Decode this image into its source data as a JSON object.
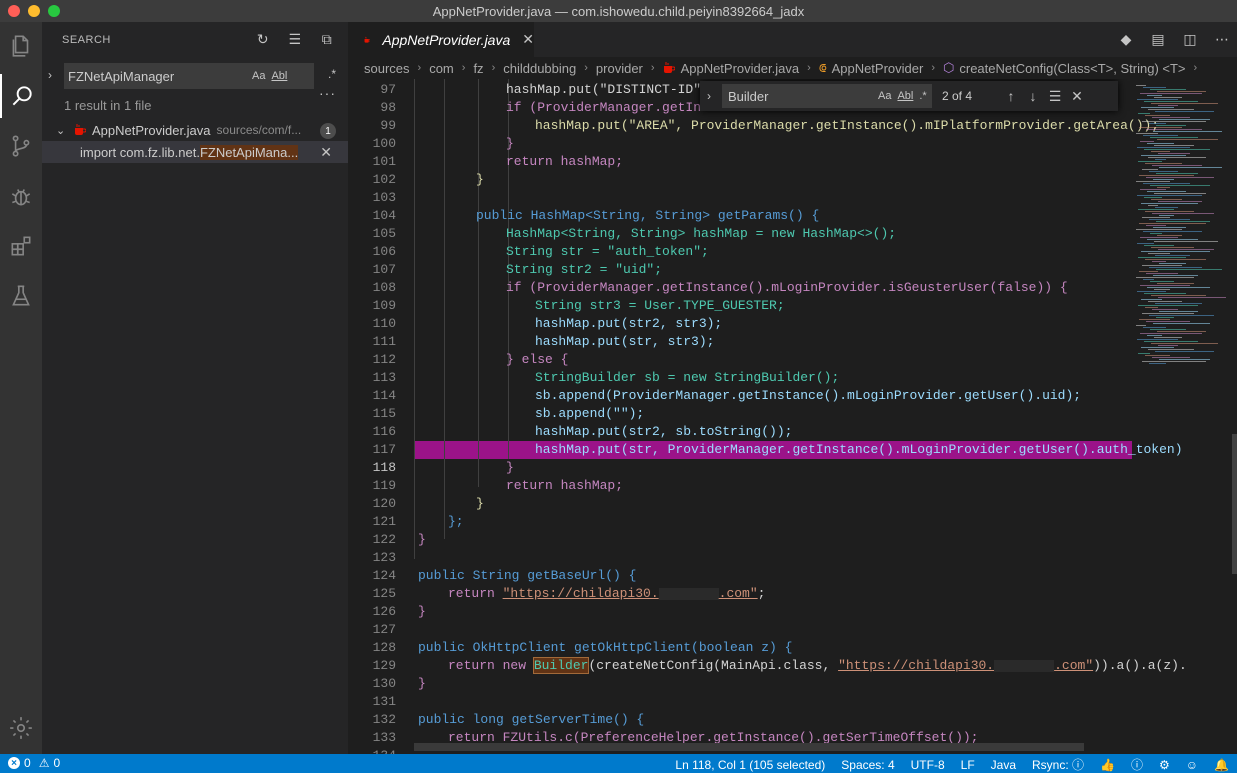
{
  "window": {
    "title": "AppNetProvider.java — com.ishowedu.child.peiyin8392664_jadx"
  },
  "colors": {
    "close": "#ff5f57",
    "minimize": "#febc2e",
    "zoom": "#28c840",
    "statusbar": "#007acc",
    "selection": "#b2129c",
    "java_icon": "#e51400"
  },
  "activitybar": {
    "icons": [
      "files-icon",
      "search-icon",
      "source-control-icon",
      "debug-icon",
      "extensions-icon",
      "testing-icon",
      "settings-gear-icon"
    ],
    "active": "search-icon"
  },
  "sidebar": {
    "title": "SEARCH",
    "actions": [
      "refresh-icon",
      "clear-results-icon",
      "collapse-all-icon"
    ],
    "query": "FZNetApiManager",
    "options": {
      "match_case": "Aa",
      "whole_word": "Abl",
      "regex": ".*"
    },
    "summary": "1 result in 1 file",
    "file": {
      "name": "AppNetProvider.java",
      "path": "sources/com/f...",
      "count": "1"
    },
    "match": {
      "prefix": "import com.fz.lib.net.",
      "highlight": "FZNetApiMana...",
      "full": "import com.fz.lib.net.FZNetApiMana..."
    }
  },
  "editor": {
    "tab": {
      "label": "AppNetProvider.java"
    },
    "breadcrumb": [
      "sources",
      "com",
      "fz",
      "childdubbing",
      "provider",
      "AppNetProvider.java",
      "AppNetProvider",
      "createNetConfig(Class<T>, String) <T>"
    ],
    "find": {
      "query": "Builder",
      "count": "2 of 4"
    },
    "current_line": "118",
    "line_numbers": [
      "97",
      "98",
      "99",
      "100",
      "101",
      "102",
      "103",
      "104",
      "105",
      "106",
      "107",
      "108",
      "109",
      "110",
      "111",
      "112",
      "113",
      "114",
      "115",
      "116",
      "117",
      "118",
      "119",
      "120",
      "121",
      "122",
      "123",
      "124",
      "125",
      "126",
      "127",
      "128",
      "129",
      "130",
      "131",
      "132",
      "133",
      "134"
    ],
    "lines": {
      "l97a": "hashMap.put(\"DISTINCT-ID\", ",
      "l98": "if (ProviderManager.getInst",
      "l99": "hashMap.put(\"AREA\", ProviderManager.getInstance().mIPlatformProvider.getArea());",
      "l100": "}",
      "l101": "return hashMap;",
      "l102": "}",
      "l104": "public HashMap<String, String> getParams() {",
      "l105": "HashMap<String, String> hashMap = new HashMap<>();",
      "l106": "String str = \"auth_token\";",
      "l107": "String str2 = \"uid\";",
      "l108": "if (ProviderManager.getInstance().mLoginProvider.isGeusterUser(false)) {",
      "l109": "String str3 = User.TYPE_GUESTER;",
      "l110": "hashMap.put(str2, str3);",
      "l111": "hashMap.put(str, str3);",
      "l112": "} else {",
      "l113": "StringBuilder sb = new StringBuilder();",
      "l114": "sb.append(ProviderManager.getInstance().mLoginProvider.getUser().uid);",
      "l115": "sb.append(\"\");",
      "l116": "hashMap.put(str2, sb.toString());",
      "l117": "hashMap.put(str, ProviderManager.getInstance().mLoginProvider.getUser().auth_token)",
      "l118": "}",
      "l119": "return hashMap;",
      "l120": "}",
      "l121": "};",
      "l122": "}",
      "l124": "public String getBaseUrl() {",
      "l125a": "return ",
      "l125b": "\"https://childapi30.",
      "l125c": ".com\"",
      "l125d": ";",
      "l126": "}",
      "l128": "public OkHttpClient getOkHttpClient(boolean z) {",
      "l129a": "return new ",
      "l129b": "Builder",
      "l129c": "(createNetConfig(MainApi.class, ",
      "l129d": "\"https://childapi30.",
      "l129e": ".com\"",
      "l129f": ")).a().a(z).",
      "l130": "}",
      "l132": "public long getServerTime() {",
      "l133": "return FZUtils.c(PreferenceHelper.getInstance().getSerTimeOffset());"
    }
  },
  "statusbar": {
    "errors": "0",
    "warnings": "0",
    "position": "Ln 118, Col 1 (105 selected)",
    "spaces": "Spaces: 4",
    "encoding": "UTF-8",
    "eol": "LF",
    "language": "Java",
    "rsync": "Rsync:"
  }
}
